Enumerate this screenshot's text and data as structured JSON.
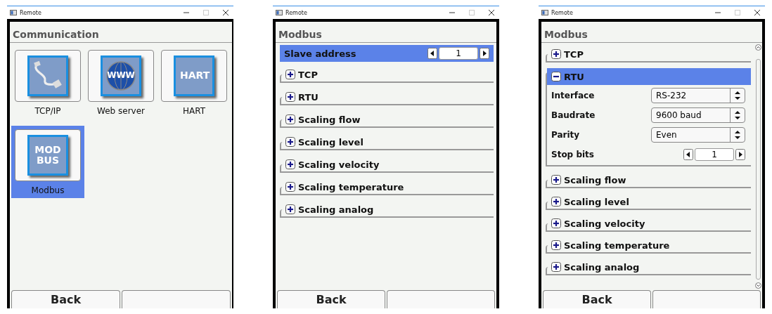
{
  "windows": [
    {
      "title": "Remote",
      "kind": "tiles",
      "header": "Communication",
      "tiles": [
        {
          "label": "TCP/IP",
          "kind": "cable",
          "selected": false
        },
        {
          "label": "Web server",
          "kind": "globe",
          "icon_text": "WWW",
          "selected": false
        },
        {
          "label": "HART",
          "kind": "text",
          "icon_text": "HART",
          "selected": false
        },
        {
          "label": "Modbus",
          "kind": "text",
          "icon_text": "MOD BUS",
          "selected": true
        }
      ],
      "buttons": [
        "Back"
      ]
    },
    {
      "title": "Remote",
      "kind": "list",
      "header": "Modbus",
      "scrollbar": false,
      "items": [
        {
          "kind": "spinner",
          "label": "Slave address",
          "value": "1",
          "selected": true
        },
        {
          "kind": "group",
          "label": "TCP",
          "expanded": false,
          "selected": false
        },
        {
          "kind": "group",
          "label": "RTU",
          "expanded": false,
          "selected": false
        },
        {
          "kind": "group",
          "label": "Scaling flow",
          "expanded": false,
          "selected": false
        },
        {
          "kind": "group",
          "label": "Scaling level",
          "expanded": false,
          "selected": false
        },
        {
          "kind": "group",
          "label": "Scaling velocity",
          "expanded": false,
          "selected": false
        },
        {
          "kind": "group",
          "label": "Scaling temperature",
          "expanded": false,
          "selected": false
        },
        {
          "kind": "group",
          "label": "Scaling analog",
          "expanded": false,
          "selected": false
        }
      ],
      "buttons": [
        "Back"
      ]
    },
    {
      "title": "Remote",
      "kind": "list",
      "header": "Modbus",
      "scrollbar": true,
      "items": [
        {
          "kind": "group",
          "label": "TCP",
          "expanded": false,
          "selected": false
        },
        {
          "kind": "group",
          "label": "RTU",
          "expanded": true,
          "selected": true,
          "children": [
            {
              "kind": "select",
              "label": "Interface",
              "value": "RS-232"
            },
            {
              "kind": "select",
              "label": "Baudrate",
              "value": "9600 baud"
            },
            {
              "kind": "select",
              "label": "Parity",
              "value": "Even"
            },
            {
              "kind": "spinner",
              "label": "Stop bits",
              "value": "1"
            }
          ]
        },
        {
          "kind": "group",
          "label": "Scaling flow",
          "expanded": false,
          "selected": false
        },
        {
          "kind": "group",
          "label": "Scaling level",
          "expanded": false,
          "selected": false
        },
        {
          "kind": "group",
          "label": "Scaling velocity",
          "expanded": false,
          "selected": false
        },
        {
          "kind": "group",
          "label": "Scaling temperature",
          "expanded": false,
          "selected": false
        },
        {
          "kind": "group",
          "label": "Scaling analog",
          "expanded": false,
          "selected": false
        }
      ],
      "buttons": [
        "Back"
      ]
    }
  ]
}
